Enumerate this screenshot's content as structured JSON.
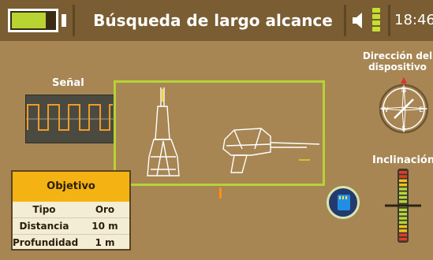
{
  "header": {
    "title": "Búsqueda de largo alcance",
    "time": "18:46",
    "battery_level": 0.8,
    "volume_icon": "speaker-icon",
    "signal_icon": "signal-bars-icon"
  },
  "signal_panel": {
    "label": "Señal"
  },
  "direction": {
    "label": "Dirección del dispositivo",
    "n": "N",
    "s": "S",
    "e": "E",
    "w": "W"
  },
  "inclination": {
    "label": "Inclinación"
  },
  "target": {
    "header": "Objetivo",
    "rows": [
      {
        "key": "Tipo",
        "value": "Oro"
      },
      {
        "key": "Distancia",
        "value": "10  m"
      },
      {
        "key": "Profundidad",
        "value": "1 m"
      }
    ]
  },
  "colors": {
    "background": "#a78654",
    "topbar": "#7a5d32",
    "accent_green": "#b7d236",
    "orange": "#f4b312",
    "compass_needle": "#e03030"
  },
  "icons": [
    "battery-icon",
    "speaker-icon",
    "signal-bars-icon",
    "compass-icon",
    "sd-card-icon",
    "inclination-gauge-icon",
    "detector-side-icon",
    "detector-top-icon"
  ]
}
